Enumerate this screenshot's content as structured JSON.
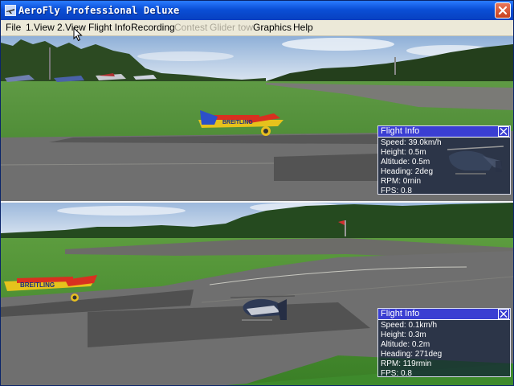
{
  "window": {
    "title": "AeroFly Professional Deluxe"
  },
  "menu": [
    {
      "label": "File",
      "enabled": true
    },
    {
      "label": "1.View",
      "enabled": true
    },
    {
      "label": "2.View",
      "enabled": true
    },
    {
      "label": "Flight Info",
      "enabled": true
    },
    {
      "label": "Recording",
      "enabled": true
    },
    {
      "label": "Contest",
      "enabled": false
    },
    {
      "label": "Glider tow",
      "enabled": false
    },
    {
      "label": "Graphics",
      "enabled": true
    },
    {
      "label": "Help",
      "enabled": true
    }
  ],
  "plane_text": "BREITLING",
  "panels": [
    {
      "title": "Flight Info",
      "speed": "Speed: 39.0km/h",
      "height": "Height: 0.5m",
      "altitude": "Altitude: 0.5m",
      "heading": "Heading:   2deg",
      "rpm": "RPM:    0rnin",
      "fps": "FPS: 0.8"
    },
    {
      "title": "Flight Info",
      "speed": "Speed: 0.1km/h",
      "height": "Height: 0.3m",
      "altitude": "Altitude: 0.2m",
      "heading": "Heading: 271deg",
      "rpm": "RPM: 119rmin",
      "fps": "FPS: 0.8"
    }
  ],
  "icons": {
    "app": "aerofly-app-icon",
    "close": "close-icon",
    "panel_close": "close-icon",
    "helicopter": "helicopter-icon",
    "cursor": "mouse-cursor-icon"
  },
  "colors": {
    "titlebar": "#0a4fd6",
    "menubar": "#ece9d8",
    "panel_title": "#3a3ed2",
    "grass": "#3f8a2e",
    "runway": "#6f6f6f"
  }
}
